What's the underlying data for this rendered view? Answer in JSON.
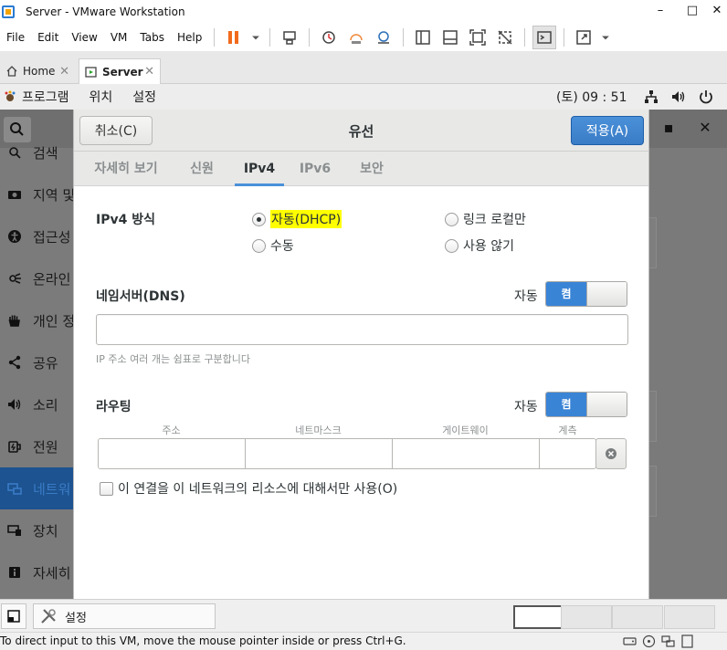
{
  "window": {
    "title": "Server - VMware Workstation"
  },
  "menu": [
    "File",
    "Edit",
    "View",
    "VM",
    "Tabs",
    "Help"
  ],
  "tabs": {
    "home": "Home",
    "server": "Server"
  },
  "gnome": {
    "applications": "프로그램",
    "places": "위치",
    "settings": "설정",
    "clock": "(토) 09 : 51"
  },
  "sidebar": {
    "items": [
      {
        "label": "검색",
        "icon": "search-icon"
      },
      {
        "label": "지역 및",
        "icon": "region-icon"
      },
      {
        "label": "접근성",
        "icon": "accessibility-icon"
      },
      {
        "label": "온라인",
        "icon": "online-accounts-icon"
      },
      {
        "label": "개인 정",
        "icon": "privacy-hand-icon"
      },
      {
        "label": "공유",
        "icon": "share-icon"
      },
      {
        "label": "소리",
        "icon": "sound-icon"
      },
      {
        "label": "전원",
        "icon": "power-icon"
      },
      {
        "label": "네트워",
        "icon": "network-icon"
      },
      {
        "label": "장치",
        "icon": "devices-icon"
      },
      {
        "label": "자세히",
        "icon": "details-icon"
      }
    ]
  },
  "dialog": {
    "cancel_label": "취소(C)",
    "title": "유선",
    "apply_label": "적용(A)",
    "tabs": [
      "자세히 보기",
      "신원",
      "IPv4",
      "IPv6",
      "보안"
    ],
    "active_tab": "IPv4",
    "method": {
      "label": "IPv4 방식",
      "options": [
        {
          "label": "자동(DHCP)",
          "checked": true
        },
        {
          "label": "링크 로컬만",
          "checked": false
        },
        {
          "label": "수동",
          "checked": false
        },
        {
          "label": "사용 않기",
          "checked": false
        }
      ]
    },
    "dns": {
      "label": "네임서버(DNS)",
      "auto_label": "자동",
      "toggle_label": "켬",
      "value": "",
      "hint": "IP 주소 여러 개는 쉼표로 구분합니다"
    },
    "routes": {
      "label": "라우팅",
      "auto_label": "자동",
      "toggle_label": "켬",
      "columns": [
        "주소",
        "네트마스크",
        "게이트웨이",
        "계측"
      ]
    },
    "only_local_label": "이 연결을 이 네트워크의 리소스에 대해서만 사용(O)"
  },
  "bottombar": {
    "settings_label": "설정"
  },
  "status": {
    "text": "To direct input to this VM, move the mouse pointer inside or press Ctrl+G."
  }
}
